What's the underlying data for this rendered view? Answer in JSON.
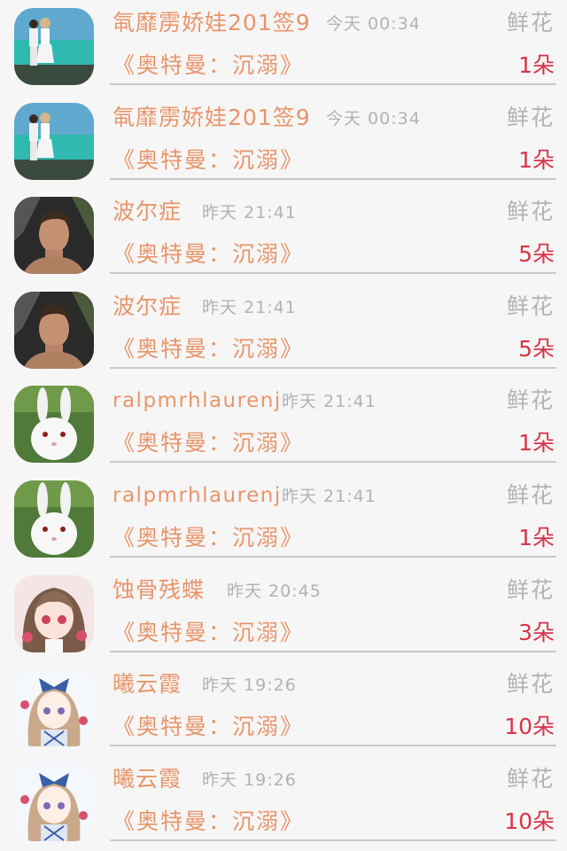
{
  "gift_records": [
    {
      "user": "㲴靡雳娇娃201签9",
      "time": "今天 00:34",
      "gift": "鲜花",
      "work": "《奥特曼：沉溺》",
      "amount": "1朵",
      "avatar_icon": "couple-beach-avatar-icon"
    },
    {
      "user": "㲴靡雳娇娃201签9",
      "time": "今天 00:34",
      "gift": "鲜花",
      "work": "《奥特曼：沉溺》",
      "amount": "1朵",
      "avatar_icon": "couple-beach-avatar-icon"
    },
    {
      "user": "波尔症",
      "time": "昨天 21:41",
      "gift": "鲜花",
      "work": "《奥特曼：沉溺》",
      "amount": "5朵",
      "avatar_icon": "man-portrait-avatar-icon"
    },
    {
      "user": "波尔症",
      "time": "昨天 21:41",
      "gift": "鲜花",
      "work": "《奥特曼：沉溺》",
      "amount": "5朵",
      "avatar_icon": "man-portrait-avatar-icon"
    },
    {
      "user": "ralpmrhlaurenj",
      "time": "昨天 21:41",
      "gift": "鲜花",
      "work": "《奥特曼：沉溺》",
      "amount": "1朵",
      "avatar_icon": "rabbit-avatar-icon"
    },
    {
      "user": "ralpmrhlaurenj",
      "time": "昨天 21:41",
      "gift": "鲜花",
      "work": "《奥特曼：沉溺》",
      "amount": "1朵",
      "avatar_icon": "rabbit-avatar-icon"
    },
    {
      "user": "蚀骨残蝶",
      "time": "昨天 20:45",
      "gift": "鲜花",
      "work": "《奥特曼：沉溺》",
      "amount": "3朵",
      "avatar_icon": "anime-girl-avatar-icon"
    },
    {
      "user": "曦云霞",
      "time": "昨天 19:26",
      "gift": "鲜花",
      "work": "《奥特曼：沉溺》",
      "amount": "10朵",
      "avatar_icon": "anime-doll-avatar-icon"
    },
    {
      "user": "曦云霞",
      "time": "昨天 19:26",
      "gift": "鲜花",
      "work": "《奥特曼：沉溺》",
      "amount": "10朵",
      "avatar_icon": "anime-doll-avatar-icon"
    }
  ],
  "colors": {
    "username": "#e8956a",
    "time": "#b2b2b2",
    "gift": "#b3b3b3",
    "amount": "#d8344a",
    "background": "#f7f6f6"
  }
}
